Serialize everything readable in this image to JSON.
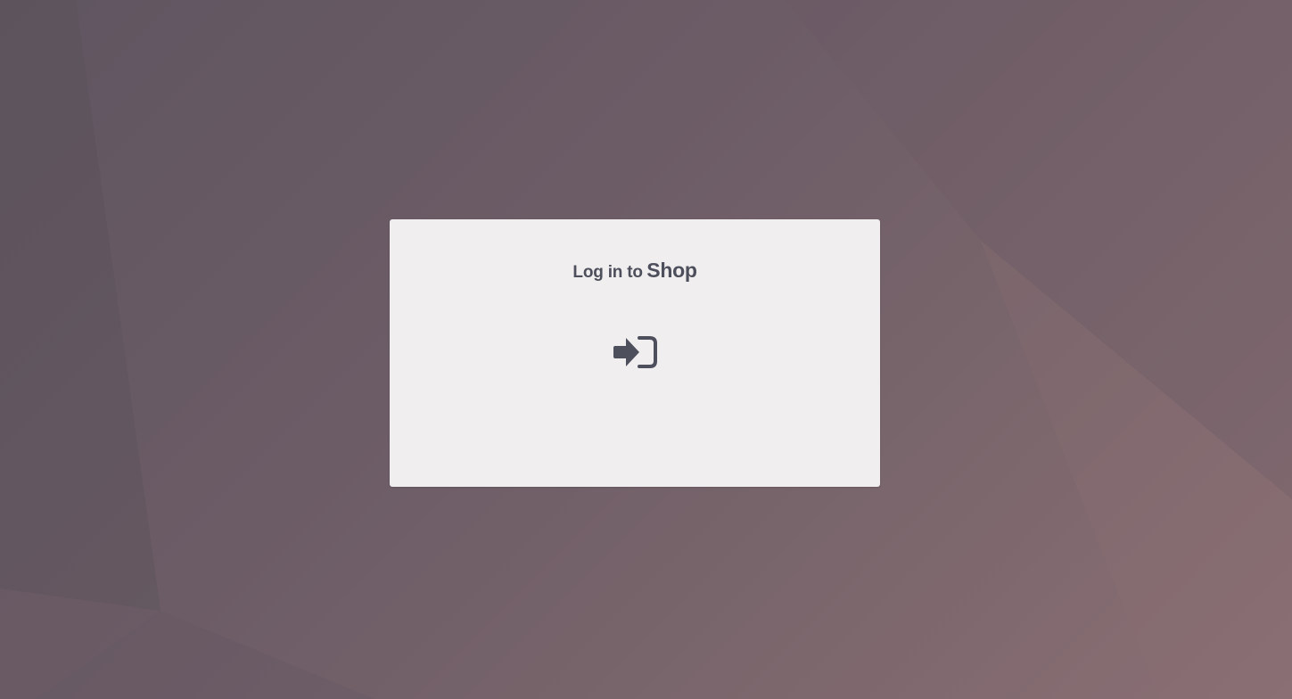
{
  "login": {
    "title_prefix": "Log in to",
    "title_brand": "Shop",
    "button_icon": "sign-in-icon"
  },
  "colors": {
    "card_background": "#f0eeef",
    "text": "#4e4f5c",
    "icon": "#4e4f5c",
    "background_dark": "#5f5560",
    "background_light": "#8a6f74"
  }
}
